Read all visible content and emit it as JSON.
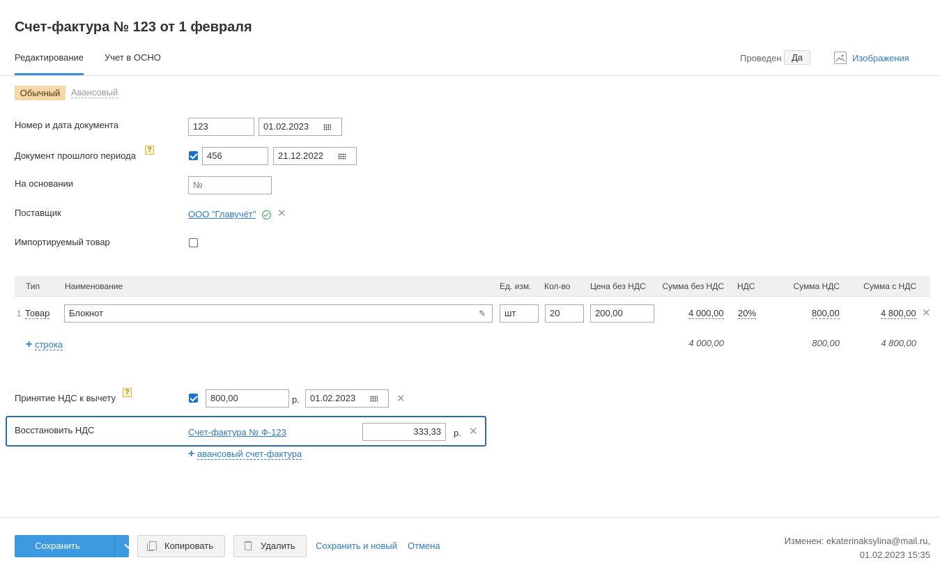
{
  "title": "Счет-фактура № 123 от 1 февраля",
  "tabs": [
    {
      "label": "Редактирование",
      "active": true
    },
    {
      "label": "Учет в ОСНО",
      "active": false
    }
  ],
  "header": {
    "posted_label": "Проведен",
    "posted_value": "Да",
    "images_label": "Изображения",
    "images_icon": "image-icon"
  },
  "type_switch": {
    "ordinary": "Обычный",
    "advance": "Авансовый"
  },
  "form": {
    "doc_number_label": "Номер и дата документа",
    "doc_number": "123",
    "doc_date": "01.02.2023",
    "prev_period_label": "Документ прошлого периода",
    "prev_period_help": "?",
    "prev_period_checked": true,
    "prev_number": "456",
    "prev_date": "21.12.2022",
    "basis_label": "На основании",
    "basis_placeholder": "№",
    "supplier_label": "Поставщик",
    "supplier_value": "ООО \"Главучёт\"",
    "imported_label": "Импортируемый товар",
    "imported_checked": false
  },
  "table": {
    "headers": [
      "Тип",
      "Наименование",
      "Ед. изм.",
      "Кол-во",
      "Цена без НДС",
      "Сумма без НДС",
      "НДС",
      "Сумма НДС",
      "Сумма с НДС"
    ],
    "rows": [
      {
        "num": "1",
        "type": "Товар",
        "name": "Блокнот",
        "unit": "шт",
        "qty": "20",
        "price": "200,00",
        "sum_no_vat": "4 000,00",
        "vat_rate": "20%",
        "vat_sum": "800,00",
        "sum_with_vat": "4 800,00"
      }
    ],
    "add_row": "строка",
    "totals": {
      "sum_no_vat": "4 000,00",
      "vat_sum": "800,00",
      "sum_with_vat": "4 800,00"
    }
  },
  "vat": {
    "deduct_label": "Принятие НДС к вычету",
    "deduct_help": "?",
    "deduct_checked": true,
    "deduct_amount": "800,00",
    "currency": "р.",
    "deduct_date": "01.02.2023",
    "restore_label": "Восстановить НДС",
    "restore_link": "Счет-фактура № Ф-123",
    "restore_amount": "333,33",
    "add_advance": "авансовый счет-фактура"
  },
  "footer": {
    "save": "Сохранить",
    "copy": "Копировать",
    "delete": "Удалить",
    "save_new": "Сохранить и новый",
    "cancel": "Отмена",
    "changed_by": "Изменен: ekaterinaksylina@mail.ru,",
    "changed_at": "01.02.2023 15:35"
  },
  "colors": {
    "accent": "#3d9ae0",
    "link": "#2f7bc2",
    "badge": "#f4d8a5",
    "highlight_border": "#2c6aa8"
  }
}
